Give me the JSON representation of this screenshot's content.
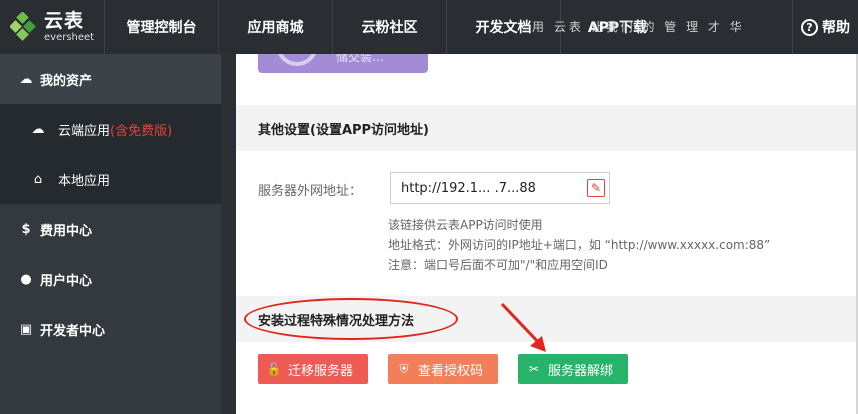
{
  "brand": {
    "name": "云表",
    "sub": "eversheet"
  },
  "nav": [
    "管理控制台",
    "应用商城",
    "云粉社区",
    "开发文档",
    "APP下载"
  ],
  "nav_overlay": "用 云表 让我们 的 管 理 才 华",
  "help": "帮助",
  "sidebar": {
    "my_assets": "我的资产",
    "cloud_app": "云端应用",
    "cloud_app_note": "(含免费版)",
    "local_app": "本地应用",
    "billing": "费用中心",
    "user_center": "用户中心",
    "dev_center": "开发者中心"
  },
  "purple_button_text": "储交装…",
  "other_settings": {
    "title": "其他设置(设置APP访问地址)",
    "label": "服务器外网地址：",
    "value": "http://192.1... .7...88",
    "notes": [
      "该链接供云表APP访问时使用",
      "地址格式：外网访问的IP地址+端口，如 “http://www.xxxxx.com:88”",
      "注意：端口号后面不可加\"/\"和应用空间ID"
    ]
  },
  "special": {
    "title": "安装过程特殊情况处理方法",
    "buttons": [
      "迁移服务器",
      "查看授权码",
      "服务器解绑"
    ]
  },
  "colors": {
    "topbar": "#2a2e32",
    "sidebar": "#33393e",
    "red_btn": "#ee5a54",
    "orange_btn": "#f37f5a",
    "green_btn": "#28b36b",
    "annotation": "#e1261c"
  }
}
